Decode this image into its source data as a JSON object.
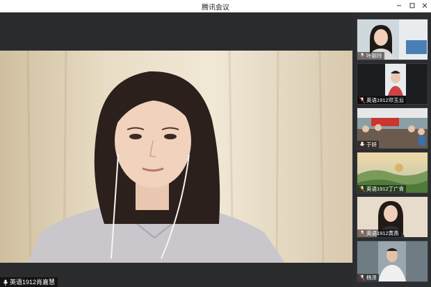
{
  "window": {
    "title": "腾讯会议",
    "minimize_icon": "minimize-icon",
    "maximize_icon": "maximize-icon",
    "close_icon": "close-icon"
  },
  "main_video": {
    "speaker_name": "英语1912肖嘉慧"
  },
  "participants": [
    {
      "name": "叶丽玲"
    },
    {
      "name": "英语1912邓玉云"
    },
    {
      "name": "于妍"
    },
    {
      "name": "英语1912丁广青"
    },
    {
      "name": "英语1912黄燕"
    },
    {
      "name": "杨泽"
    }
  ],
  "colors": {
    "bg": "#1e1f21",
    "sidebar": "#2c2d30",
    "mic_accent": "#e0533d"
  }
}
